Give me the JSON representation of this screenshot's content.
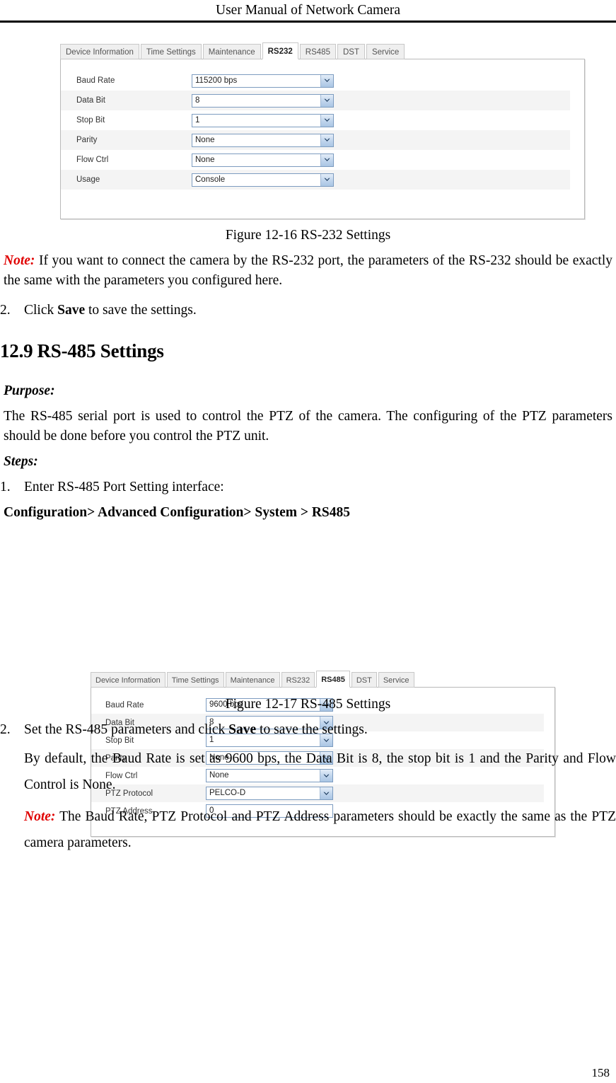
{
  "page": {
    "running_header": "User Manual of Network Camera",
    "page_number": "158"
  },
  "figure_rs232": {
    "caption": "Figure 12-16 RS-232 Settings",
    "tabs": [
      {
        "label": "Device Information",
        "active": false
      },
      {
        "label": "Time Settings",
        "active": false
      },
      {
        "label": "Maintenance",
        "active": false
      },
      {
        "label": "RS232",
        "active": true
      },
      {
        "label": "RS485",
        "active": false
      },
      {
        "label": "DST",
        "active": false
      },
      {
        "label": "Service",
        "active": false
      }
    ],
    "rows": [
      {
        "label": "Baud Rate",
        "value": "115200 bps",
        "control": "select"
      },
      {
        "label": "Data Bit",
        "value": "8",
        "control": "select"
      },
      {
        "label": "Stop Bit",
        "value": "1",
        "control": "select"
      },
      {
        "label": "Parity",
        "value": "None",
        "control": "select"
      },
      {
        "label": "Flow Ctrl",
        "value": "None",
        "control": "select"
      },
      {
        "label": "Usage",
        "value": "Console",
        "control": "select"
      }
    ]
  },
  "figure_rs485": {
    "caption": "Figure 12-17 RS-485 Settings",
    "tabs": [
      {
        "label": "Device Information",
        "active": false
      },
      {
        "label": "Time Settings",
        "active": false
      },
      {
        "label": "Maintenance",
        "active": false
      },
      {
        "label": "RS232",
        "active": false
      },
      {
        "label": "RS485",
        "active": true
      },
      {
        "label": "DST",
        "active": false
      },
      {
        "label": "Service",
        "active": false
      }
    ],
    "rows": [
      {
        "label": "Baud Rate",
        "value": "9600 bps",
        "control": "select"
      },
      {
        "label": "Data Bit",
        "value": "8",
        "control": "select"
      },
      {
        "label": "Stop Bit",
        "value": "1",
        "control": "select"
      },
      {
        "label": "Parity",
        "value": "None",
        "control": "select"
      },
      {
        "label": "Flow Ctrl",
        "value": "None",
        "control": "select"
      },
      {
        "label": "PTZ Protocol",
        "value": "PELCO-D",
        "control": "select"
      },
      {
        "label": "PTZ Address",
        "value": "0",
        "control": "text"
      }
    ]
  },
  "body": {
    "note1_label": "Note:",
    "note1_text": " If you want to connect the camera by the RS-232 port, the parameters of the RS-232 should be exactly the same with the parameters you configured here.",
    "step2_rs232_marker": "2.",
    "step2_rs232_pre": "Click ",
    "step2_rs232_bold": "Save",
    "step2_rs232_post": " to save the settings.",
    "heading_number": "12.9",
    "heading_title": "RS-485 Settings",
    "purpose_label": "Purpose:",
    "purpose_text": "The RS-485 serial port is used to control the PTZ of the camera. The configuring of the PTZ parameters should be done before you control the PTZ unit.",
    "steps_label": "Steps:",
    "step1_marker": "1.",
    "step1_text": "Enter RS-485 Port Setting interface:",
    "config_path": "Configuration> Advanced Configuration> System > RS485",
    "step2_rs485_marker": "2.",
    "step2_rs485_pre": "Set the RS-485 parameters and click ",
    "step2_rs485_bold": "Save",
    "step2_rs485_post": " to save the settings.",
    "default_text": "By default, the Baud Rate is set as 9600 bps, the Data Bit is 8, the stop bit is 1 and the Parity and Flow Control is None.",
    "note2_label": "Note:",
    "note2_text": " The Baud Rate, PTZ Protocol and PTZ Address parameters should be exactly the same as the PTZ camera parameters."
  },
  "colors": {
    "note_red": "#e00000",
    "row_stripe": "#f4f4f4",
    "panel_border": "#b9b9b9",
    "control_border": "#7d9cc0"
  }
}
